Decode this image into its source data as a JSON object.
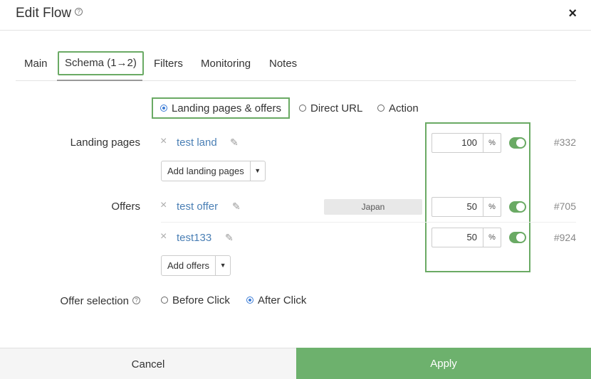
{
  "dialog": {
    "title": "Edit Flow",
    "close_label": "×",
    "help_glyph": "?"
  },
  "tabs": [
    {
      "label": "Main"
    },
    {
      "label": "Schema (1→2)"
    },
    {
      "label": "Filters"
    },
    {
      "label": "Monitoring"
    },
    {
      "label": "Notes"
    }
  ],
  "mode": {
    "options": [
      {
        "label": "Landing pages & offers",
        "checked": true
      },
      {
        "label": "Direct URL",
        "checked": false
      },
      {
        "label": "Action",
        "checked": false
      }
    ]
  },
  "landing_pages": {
    "label": "Landing pages",
    "items": [
      {
        "name": "test land",
        "weight": "100",
        "unit": "%",
        "enabled": true,
        "id": "#332"
      }
    ],
    "add_label": "Add landing pages",
    "caret": "▼"
  },
  "offers": {
    "label": "Offers",
    "items": [
      {
        "name": "test offer",
        "country": "Japan",
        "weight": "50",
        "unit": "%",
        "enabled": true,
        "id": "#705"
      },
      {
        "name": "test133",
        "weight": "50",
        "unit": "%",
        "enabled": true,
        "id": "#924"
      }
    ],
    "add_label": "Add offers",
    "caret": "▼"
  },
  "offer_selection": {
    "label": "Offer selection",
    "options": [
      {
        "label": "Before Click",
        "checked": false
      },
      {
        "label": "After Click",
        "checked": true
      }
    ]
  },
  "icons": {
    "remove": "×",
    "edit": "✎"
  },
  "footer": {
    "cancel_label": "Cancel",
    "apply_label": "Apply"
  },
  "colors": {
    "accent_green": "#6aaa64",
    "apply_bg": "#6db16d",
    "link_blue": "#4a7fb5",
    "radio_blue": "#3a7bd5"
  }
}
